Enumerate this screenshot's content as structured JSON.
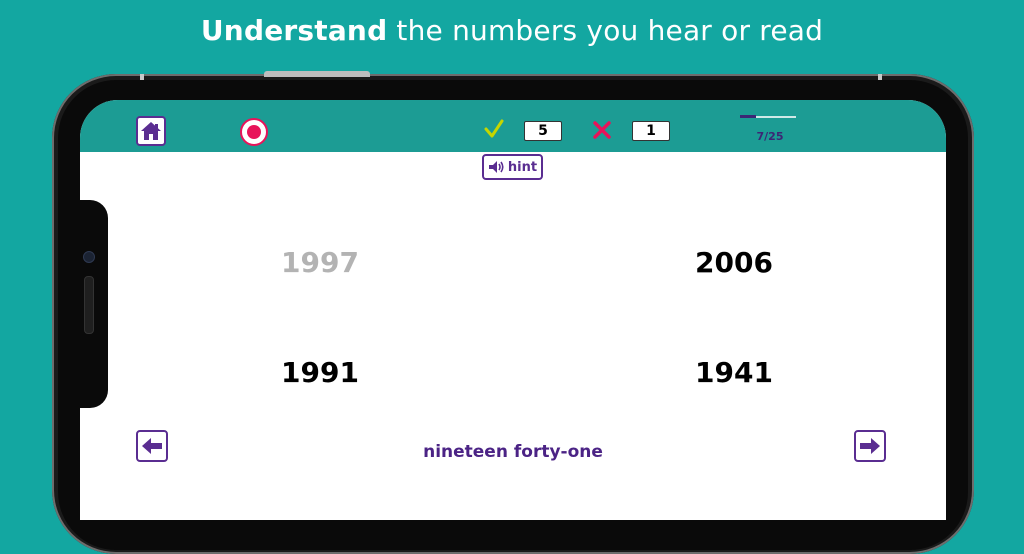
{
  "headline": {
    "bold": "Understand",
    "rest": " the numbers you hear or read"
  },
  "toolbar": {
    "correct_count": "5",
    "wrong_count": "1",
    "progress_label": "7/25",
    "progress_fraction": 0.28
  },
  "hint": {
    "label": "hint",
    "icon": "speaker-icon"
  },
  "choices": [
    {
      "value": "1997",
      "state": "dimmed"
    },
    {
      "value": "2006",
      "state": "normal"
    },
    {
      "value": "1991",
      "state": "normal"
    },
    {
      "value": "1941",
      "state": "normal"
    }
  ],
  "answer": {
    "text": "nineteen forty-one"
  },
  "colors": {
    "background": "#13a7a1",
    "topbar": "#1c9c94",
    "accent_purple": "#5a2d91",
    "record_red": "#e8135a",
    "check_yellow": "#c6d600",
    "cross_pink": "#e8135a"
  },
  "icons": [
    "home-icon",
    "record-icon",
    "check-icon",
    "cross-icon",
    "speaker-icon",
    "arrow-left-icon",
    "arrow-right-icon"
  ]
}
